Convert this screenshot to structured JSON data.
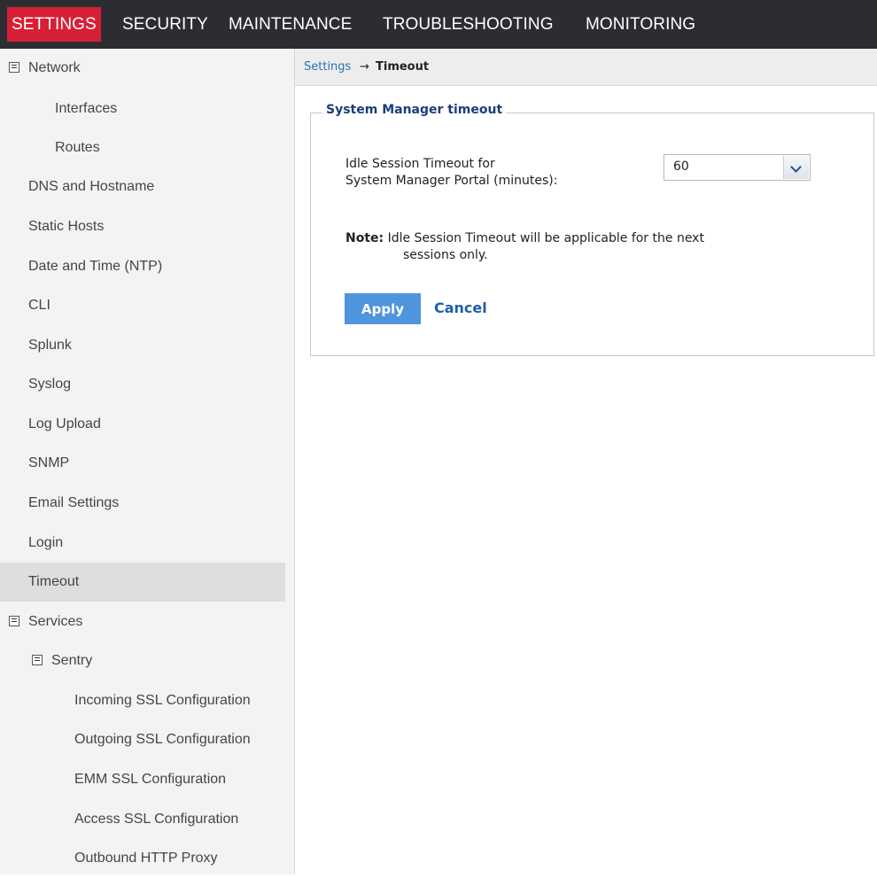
{
  "topnav": {
    "tabs": [
      {
        "label": "SETTINGS",
        "active": true
      },
      {
        "label": "SECURITY",
        "active": false
      },
      {
        "label": "MAINTENANCE",
        "active": false
      },
      {
        "label": "TROUBLESHOOTING",
        "active": false
      },
      {
        "label": "MONITORING",
        "active": false
      }
    ],
    "active_color": "#d71f36",
    "bar_color": "#2c2d33"
  },
  "sidebar": {
    "items": [
      {
        "label": "Network",
        "icon": "collapse-icon"
      },
      {
        "label": "Interfaces"
      },
      {
        "label": "Routes"
      },
      {
        "label": "DNS and Hostname"
      },
      {
        "label": "Static Hosts"
      },
      {
        "label": "Date and Time (NTP)"
      },
      {
        "label": "CLI"
      },
      {
        "label": "Splunk"
      },
      {
        "label": "Syslog"
      },
      {
        "label": "Log Upload"
      },
      {
        "label": "SNMP"
      },
      {
        "label": "Email Settings"
      },
      {
        "label": "Login"
      },
      {
        "label": "Timeout",
        "selected": true
      },
      {
        "label": "Services",
        "icon": "collapse-icon"
      },
      {
        "label": "Sentry",
        "icon": "collapse-icon"
      },
      {
        "label": "Incoming SSL Configuration"
      },
      {
        "label": "Outgoing SSL Configuration"
      },
      {
        "label": "EMM SSL Configuration"
      },
      {
        "label": "Access SSL Configuration"
      },
      {
        "label": "Outbound HTTP Proxy"
      }
    ]
  },
  "breadcrumb": {
    "parent": "Settings",
    "arrow": "→",
    "current": "Timeout"
  },
  "panel": {
    "legend": "System Manager timeout",
    "field_label_line1": "Idle Session Timeout for",
    "field_label_line2": "System Manager Portal (minutes):",
    "timeout_value": "60",
    "note_prefix": "Note:",
    "note_text": " Idle Session Timeout will be applicable for the next",
    "note_text_cont": "sessions only.",
    "apply_label": "Apply",
    "cancel_label": "Cancel"
  }
}
